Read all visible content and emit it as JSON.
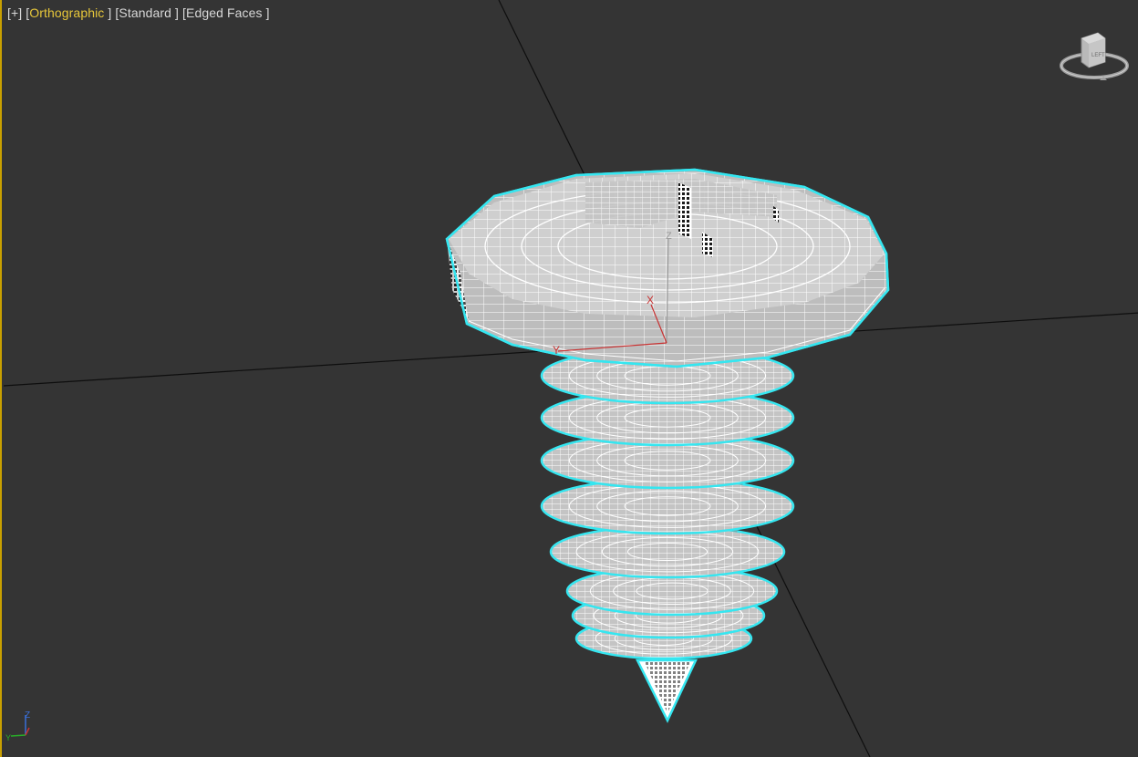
{
  "viewport": {
    "menu": {
      "plus": "[+]",
      "view_label": "Orthographic",
      "shading_label": "Standard",
      "edged_label": "Edged Faces"
    },
    "colors": {
      "background": "#343434",
      "active_label": "#e7c73a",
      "selection_outline": "#35e6f0",
      "mesh_fill": "#c9c9c9",
      "mesh_wire": "#ffffff",
      "gizmo_x": "#c83232",
      "gizmo_y": "#c83232",
      "gizmo_z": "#9a9a9a"
    },
    "gizmo": {
      "x_label": "X",
      "y_label": "Y",
      "z_label": "Z"
    },
    "viewcube": {
      "face_label": "LEFT"
    },
    "tripod": {
      "z_label": "Z",
      "y_label": "Y"
    },
    "object": {
      "name": "screw",
      "selected": true
    }
  }
}
